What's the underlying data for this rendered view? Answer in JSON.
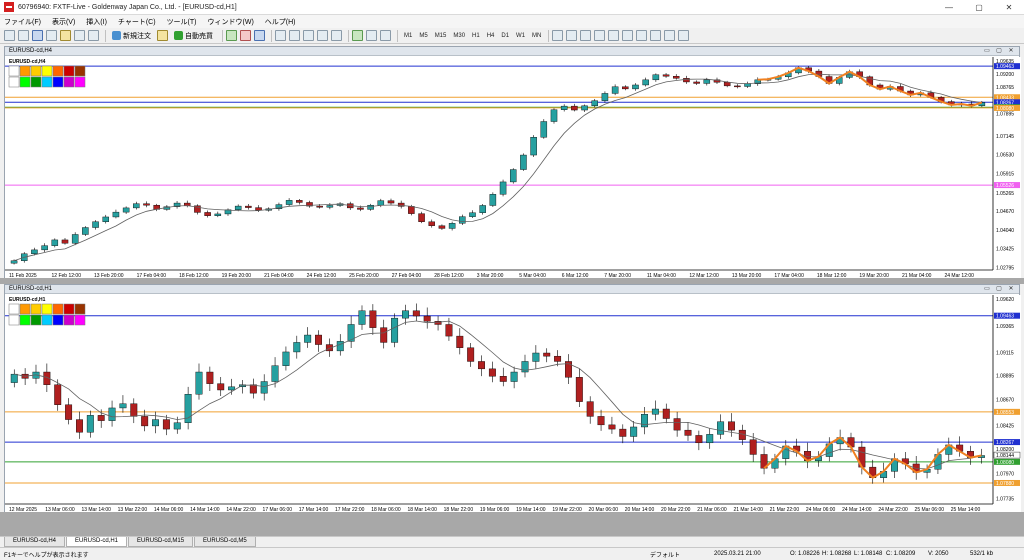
{
  "window": {
    "title": "60796940: FXTF-Live - Goldenway Japan Co., Ltd. - [EURUSD-cd,H1]"
  },
  "menu": [
    "ファイル(F)",
    "表示(V)",
    "挿入(I)",
    "チャート(C)",
    "ツール(T)",
    "ウィンドウ(W)",
    "ヘルプ(H)"
  ],
  "toolbar": {
    "new_order": "新規注文",
    "auto_trade": "自動売買",
    "timeframes": [
      "M1",
      "M5",
      "M15",
      "M30",
      "H1",
      "H4",
      "D1",
      "W1",
      "MN"
    ]
  },
  "colors": {
    "bull": "#26a0a0",
    "bear": "#b02020",
    "ma": "#606060",
    "blue_line": "#2030d0",
    "orange_line": "#f0a030",
    "green_line": "#30a030",
    "pink_line": "#f060f0",
    "zigzag": "#f08020"
  },
  "chart_h4": {
    "window_title": "EURUSD-cd,H4",
    "symbol": "EURUSD-cd,H4",
    "y_ticks": [
      "1.09635",
      "1.09200",
      "1.08765",
      "1.08330",
      "1.07895",
      "1.07145",
      "1.06530",
      "1.05915",
      "1.05265",
      "1.04670",
      "1.04040",
      "1.03425",
      "1.02795"
    ],
    "y_range": [
      1.0278,
      1.097
    ],
    "x_labels": [
      "11 Feb 2025",
      "12 Feb 12:00",
      "13 Feb 20:00",
      "17 Feb 04:00",
      "18 Feb 12:00",
      "19 Feb 20:00",
      "21 Feb 04:00",
      "24 Feb 12:00",
      "25 Feb 20:00",
      "27 Feb 04:00",
      "28 Feb 12:00",
      "3 Mar 20:00",
      "5 Mar 04:00",
      "6 Mar 12:00",
      "7 Mar 20:00",
      "11 Mar 04:00",
      "12 Mar 12:00",
      "13 Mar 20:00",
      "17 Mar 04:00",
      "18 Mar 12:00",
      "19 Mar 20:00",
      "21 Mar 04:00",
      "24 Mar 12:00"
    ],
    "hlines": [
      {
        "price": 1.09463,
        "color": "blue_line",
        "label": "1.09463"
      },
      {
        "price": 1.08433,
        "color": "orange_line",
        "label": "1.08433"
      },
      {
        "price": 1.08267,
        "color": "blue_line",
        "label": "1.08267"
      },
      {
        "price": 1.08103,
        "color": "green_line",
        "label": "1.08103"
      },
      {
        "price": 1.0808,
        "color": "orange_line",
        "label": "1.08080"
      },
      {
        "price": 1.05526,
        "color": "pink_line",
        "label": "1.05526"
      }
    ],
    "closes": [
      1.0302,
      1.0325,
      1.0338,
      1.0352,
      1.0371,
      1.036,
      1.0389,
      1.0412,
      1.0431,
      1.0447,
      1.0463,
      1.0477,
      1.0491,
      1.0486,
      1.0472,
      1.0481,
      1.0493,
      1.0484,
      1.0462,
      1.0451,
      1.0457,
      1.0471,
      1.0483,
      1.0478,
      1.0469,
      1.0474,
      1.0488,
      1.0502,
      1.0495,
      1.0483,
      1.0479,
      1.0485,
      1.0491,
      1.0477,
      1.0472,
      1.0486,
      1.0501,
      1.0493,
      1.0482,
      1.0458,
      1.0431,
      1.0418,
      1.0409,
      1.0426,
      1.0448,
      1.0461,
      1.0485,
      1.0522,
      1.0563,
      1.0604,
      1.0652,
      1.0711,
      1.0763,
      1.0802,
      1.0814,
      1.0801,
      1.0815,
      1.0832,
      1.0856,
      1.0878,
      1.0871,
      1.0884,
      1.0901,
      1.0918,
      1.0913,
      1.0906,
      1.0894,
      1.0889,
      1.0901,
      1.0893,
      1.0881,
      1.0879,
      1.0888,
      1.0901,
      1.0903,
      1.0911,
      1.0924,
      1.0941,
      1.093,
      1.0912,
      1.0889,
      1.0909,
      1.0928,
      1.0911,
      1.0884,
      1.087,
      1.0879,
      1.0864,
      1.0851,
      1.0858,
      1.0843,
      1.0829,
      1.0818,
      1.0821,
      1.0815,
      1.0826
    ]
  },
  "chart_h1": {
    "window_title": "EURUSD-cd,H1",
    "symbol": "EURUSD-cd,H1",
    "y_ticks": [
      "1.09620",
      "1.09365",
      "1.09115",
      "1.08895",
      "1.08670",
      "1.08425",
      "1.08200",
      "1.07970",
      "1.07735"
    ],
    "y_range": [
      1.077,
      1.0964
    ],
    "x_labels": [
      "12 Mar 2025",
      "13 Mar 06:00",
      "13 Mar 14:00",
      "13 Mar 22:00",
      "14 Mar 06:00",
      "14 Mar 14:00",
      "14 Mar 22:00",
      "17 Mar 06:00",
      "17 Mar 14:00",
      "17 Mar 22:00",
      "18 Mar 06:00",
      "18 Mar 14:00",
      "18 Mar 22:00",
      "19 Mar 06:00",
      "19 Mar 14:00",
      "19 Mar 22:00",
      "20 Mar 06:00",
      "20 Mar 14:00",
      "20 Mar 22:00",
      "21 Mar 06:00",
      "21 Mar 14:00",
      "21 Mar 22:00",
      "24 Mar 06:00",
      "24 Mar 14:00",
      "24 Mar 22:00",
      "25 Mar 06:00",
      "25 Mar 14:00"
    ],
    "hlines": [
      {
        "price": 1.09463,
        "color": "blue_line",
        "label": "1.09463"
      },
      {
        "price": 1.08553,
        "color": "orange_line",
        "label": "1.08553"
      },
      {
        "price": 1.08267,
        "color": "blue_line",
        "label": "1.08267"
      },
      {
        "price": 1.08144,
        "color": "none",
        "label": "1.08144"
      },
      {
        "price": 1.0808,
        "color": "green_line",
        "label": "1.08080"
      },
      {
        "price": 1.0788,
        "color": "orange_line",
        "label": "1.07880"
      }
    ],
    "closes": [
      1.0891,
      1.0887,
      1.0893,
      1.0881,
      1.0862,
      1.0848,
      1.0836,
      1.0852,
      1.0847,
      1.0859,
      1.0863,
      1.0851,
      1.0842,
      1.0848,
      1.0839,
      1.0845,
      1.0872,
      1.0893,
      1.0882,
      1.0876,
      1.0879,
      1.0881,
      1.0873,
      1.0884,
      1.0899,
      1.0912,
      1.0921,
      1.0928,
      1.0919,
      1.0913,
      1.0922,
      1.0938,
      1.0951,
      1.0935,
      1.0921,
      1.0944,
      1.0951,
      1.0946,
      1.0941,
      1.0938,
      1.0927,
      1.0916,
      1.0903,
      1.0896,
      1.0889,
      1.0884,
      1.0893,
      1.0903,
      1.0911,
      1.0908,
      1.0903,
      1.0888,
      1.0865,
      1.0851,
      1.0843,
      1.0839,
      1.0832,
      1.0841,
      1.0853,
      1.0858,
      1.0849,
      1.0838,
      1.0833,
      1.0826,
      1.0834,
      1.0846,
      1.0838,
      1.0829,
      1.0815,
      1.0802,
      1.0811,
      1.0823,
      1.0818,
      1.0809,
      1.0813,
      1.0825,
      1.0831,
      1.0822,
      1.0803,
      1.0793,
      1.0799,
      1.0811,
      1.0806,
      1.0798,
      1.0801,
      1.0815,
      1.0824,
      1.0818,
      1.0812,
      1.0814
    ]
  },
  "tabs": [
    "EURUSD-cd,H4",
    "EURUSD-cd,H1",
    "EURUSD-cd,M15",
    "EURUSD-cd,M5"
  ],
  "active_tab": 1,
  "status": {
    "help": "F1キーでヘルプが表示されます",
    "profile": "デフォルト",
    "time": "2025.03.21 21:00",
    "open": "O: 1.08226",
    "high": "H: 1.08268",
    "low": "L: 1.08148",
    "close": "C: 1.08209",
    "volume": "V: 2050",
    "net": "532/1 kb"
  }
}
